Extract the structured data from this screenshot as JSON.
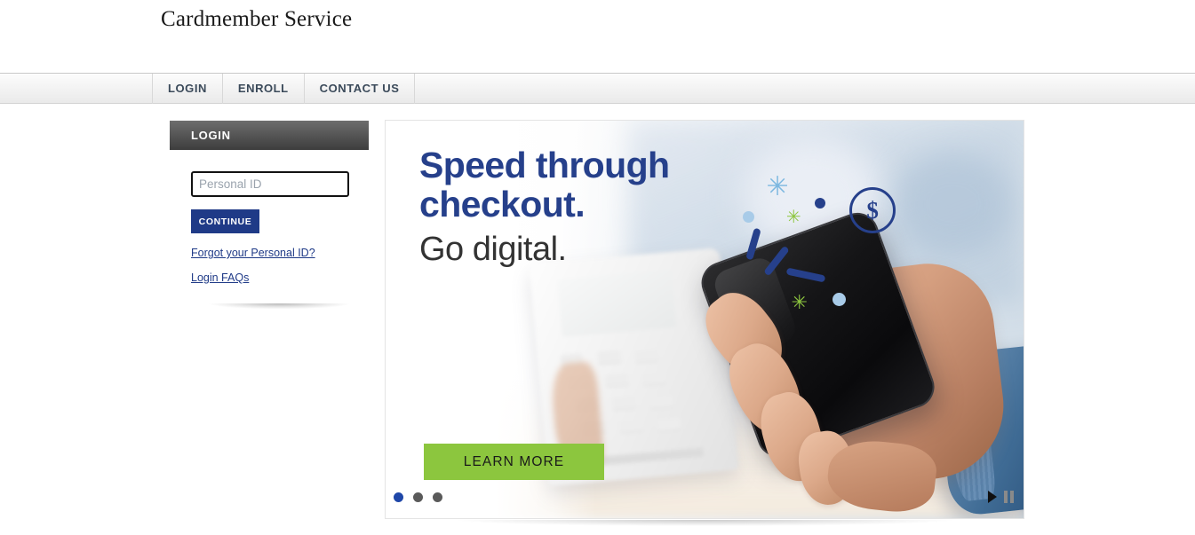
{
  "brand": {
    "name": "Cardmember Service"
  },
  "nav": {
    "items": [
      {
        "label": "LOGIN"
      },
      {
        "label": "ENROLL"
      },
      {
        "label": "CONTACT US"
      }
    ]
  },
  "login": {
    "header": "LOGIN",
    "personal_id_placeholder": "Personal ID",
    "personal_id_value": "",
    "continue_label": "CONTINUE",
    "forgot_link": "Forgot your Personal ID?",
    "faq_link": "Login FAQs"
  },
  "hero": {
    "headline_bold": "Speed through checkout.",
    "headline_light": "Go digital.",
    "cta_label": "LEARN MORE",
    "coin_symbol": "$",
    "sparkle_glyph": "✳",
    "dots": [
      {
        "active": true
      },
      {
        "active": false
      },
      {
        "active": false
      }
    ],
    "colors": {
      "navy": "#26408b",
      "green": "#8cc63e",
      "light_blue": "#a8cbe8",
      "charcoal": "#333333"
    }
  },
  "theme": {
    "link_navy": "#1f3a87",
    "button_navy": "#1f3a87",
    "nav_text": "#3b4a5a"
  }
}
